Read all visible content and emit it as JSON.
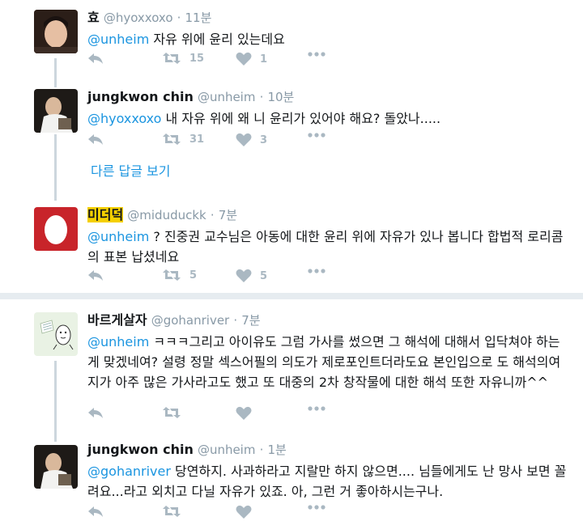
{
  "tweets": [
    {
      "name": "효",
      "handle": "@hyoxxoxo",
      "dot": "·",
      "time": "11분",
      "mention": "@unheim",
      "text": " 자유 위에 윤리 있는데요",
      "retweets": "15",
      "likes": "1"
    },
    {
      "name": "jungkwon chin",
      "handle": "@unheim",
      "dot": "·",
      "time": "10분",
      "mention": "@hyoxxoxo",
      "text": " 내 자유 위에 왜 니 윤리가 있어야 해요? 돌았나.....",
      "retweets": "31",
      "likes": "3"
    },
    {
      "name": "미더덕",
      "handle": "@miduduckk",
      "dot": "·",
      "time": "7분",
      "mention": "@unheim",
      "text": " ? 진중권 교수님은 아동에 대한 윤리 위에 자유가 있나 봅니다 합법적 로리콤의 표본 납셨네요",
      "retweets": "5",
      "likes": "5"
    },
    {
      "name": "바르게살자",
      "handle": "@gohanriver",
      "dot": "·",
      "time": "7분",
      "mention": "@unheim",
      "text": " ㅋㅋㅋ그리고 아이유도 그럼 가사를 썼으면 그 해석에 대해서 입닥쳐야 하는게 맞겠네여? 설령 정말 섹스어필의 의도가 제로포인트더라도요 본인입으로 도 해석의여지가 아주 많은 가사라고도 했고 또 대중의 2차 창작물에 대한 해석 또한 자유니까^^",
      "retweets": "",
      "likes": ""
    },
    {
      "name": "jungkwon chin",
      "handle": "@unheim",
      "dot": "·",
      "time": "1분",
      "mention": "@gohanriver",
      "text": " 당연하지. 사과하라고 지랄만 하지 않으면.... 님들에게도 난 망사 보면 꼴려요...라고 외치고 다닐 자유가 있죠. 아, 그런 거 좋아하시는구나.",
      "retweets": "",
      "likes": ""
    }
  ],
  "show_more": "다른 답글 보기",
  "icons": {
    "reply": "reply-icon",
    "retweet": "retweet-icon",
    "like": "heart-icon",
    "more": "more-icon"
  },
  "colors": {
    "link": "#1b95e0",
    "muted": "#8899a6",
    "icon": "#aab8c2",
    "thread_line": "#ccd6dd",
    "separator": "#e6ecf0",
    "highlight_name": "#f5d000"
  }
}
